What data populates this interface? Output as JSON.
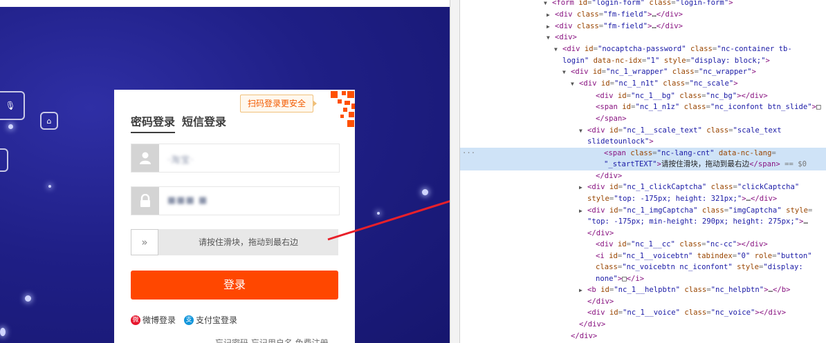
{
  "login": {
    "qr_hint": "扫码登录更安全",
    "tabs": [
      "密码登录",
      "短信登录"
    ],
    "username_value": "·淘宝·",
    "password_value": "■■■  ■",
    "slider_handle": "»",
    "slider_text": "请按住滑块，拖动到最右边",
    "login_button": "登录",
    "alt_logins": [
      {
        "label": "微博登录",
        "icon": "weibo-icon",
        "color": "#e6162d"
      },
      {
        "label": "支付宝登录",
        "icon": "alipay-icon",
        "color": "#1296db"
      }
    ],
    "footer_links": "忘记密码   忘记用户名   免费注册"
  },
  "colors": {
    "banner": "#1f1f86",
    "login_button": "#ff4700",
    "devtools_highlight": "#cfe3f7"
  },
  "devtools": {
    "lines": [
      {
        "tri": "▼",
        "parts": [
          [
            "t",
            "<form "
          ],
          [
            "an",
            "id"
          ],
          [
            "eq",
            "="
          ],
          [
            "av",
            "\"login-form\""
          ],
          [
            "an",
            " class"
          ],
          [
            "eq",
            "="
          ],
          [
            "av",
            "\"login-form\""
          ],
          [
            "t",
            ">"
          ]
        ]
      },
      {
        "tri": "▶",
        "parts": [
          [
            "t",
            "<div "
          ],
          [
            "an",
            "class"
          ],
          [
            "eq",
            "="
          ],
          [
            "av",
            "\"fm-field\""
          ],
          [
            "t",
            ">"
          ],
          [
            "tx",
            "…"
          ],
          [
            "t",
            "</div>"
          ]
        ]
      },
      {
        "tri": "▶",
        "parts": [
          [
            "t",
            "<div "
          ],
          [
            "an",
            "class"
          ],
          [
            "eq",
            "="
          ],
          [
            "av",
            "\"fm-field\""
          ],
          [
            "t",
            ">"
          ],
          [
            "tx",
            "…"
          ],
          [
            "t",
            "</div>"
          ]
        ]
      },
      {
        "tri": "▼",
        "parts": [
          [
            "t",
            "<div>"
          ]
        ]
      },
      {
        "tri": "▼",
        "parts": [
          [
            "t",
            "<div "
          ],
          [
            "an",
            "id"
          ],
          [
            "eq",
            "="
          ],
          [
            "av",
            "\"nocaptcha-password\""
          ],
          [
            "an",
            " class"
          ],
          [
            "eq",
            "="
          ],
          [
            "av",
            "\"nc-container tb-"
          ]
        ]
      },
      {
        "tri": "",
        "parts": [
          [
            "av",
            "login\""
          ],
          [
            "an",
            " data-nc-idx"
          ],
          [
            "eq",
            "="
          ],
          [
            "av",
            "\"1\""
          ],
          [
            "an",
            " style"
          ],
          [
            "eq",
            "="
          ],
          [
            "av",
            "\"display: block;\""
          ],
          [
            "t",
            ">"
          ]
        ]
      },
      {
        "tri": "▼",
        "parts": [
          [
            "t",
            "<div "
          ],
          [
            "an",
            "id"
          ],
          [
            "eq",
            "="
          ],
          [
            "av",
            "\"nc_1_wrapper\""
          ],
          [
            "an",
            " class"
          ],
          [
            "eq",
            "="
          ],
          [
            "av",
            "\"nc_wrapper\""
          ],
          [
            "t",
            ">"
          ]
        ]
      },
      {
        "tri": "▼",
        "parts": [
          [
            "t",
            "<div "
          ],
          [
            "an",
            "id"
          ],
          [
            "eq",
            "="
          ],
          [
            "av",
            "\"nc_1_n1t\""
          ],
          [
            "an",
            " class"
          ],
          [
            "eq",
            "="
          ],
          [
            "av",
            "\"nc_scale\""
          ],
          [
            "t",
            ">"
          ]
        ]
      },
      {
        "tri": "",
        "parts": [
          [
            "t",
            "<div "
          ],
          [
            "an",
            "id"
          ],
          [
            "eq",
            "="
          ],
          [
            "av",
            "\"nc_1__bg\""
          ],
          [
            "an",
            " class"
          ],
          [
            "eq",
            "="
          ],
          [
            "av",
            "\"nc_bg\""
          ],
          [
            "t",
            "></div>"
          ]
        ]
      },
      {
        "tri": "",
        "parts": [
          [
            "t",
            "<span "
          ],
          [
            "an",
            "id"
          ],
          [
            "eq",
            "="
          ],
          [
            "av",
            "\"nc_1_n1z\""
          ],
          [
            "an",
            " class"
          ],
          [
            "eq",
            "="
          ],
          [
            "av",
            "\"nc_iconfont btn_slide\""
          ],
          [
            "t",
            ">"
          ],
          [
            "tx",
            "□"
          ]
        ]
      },
      {
        "tri": "",
        "parts": [
          [
            "t",
            "</span>"
          ]
        ]
      },
      {
        "tri": "▼",
        "parts": [
          [
            "t",
            "<div "
          ],
          [
            "an",
            "id"
          ],
          [
            "eq",
            "="
          ],
          [
            "av",
            "\"nc_1__scale_text\""
          ],
          [
            "an",
            " class"
          ],
          [
            "eq",
            "="
          ],
          [
            "av",
            "\"scale_text"
          ]
        ]
      },
      {
        "tri": "",
        "parts": [
          [
            "av",
            "slidetounlock\""
          ],
          [
            "t",
            ">"
          ]
        ]
      },
      {
        "tri": "",
        "parts": [
          [
            "t",
            "<span "
          ],
          [
            "an",
            "class"
          ],
          [
            "eq",
            "="
          ],
          [
            "av",
            "\"nc-lang-cnt\""
          ],
          [
            "an",
            " data-nc-lang"
          ],
          [
            "eq",
            "="
          ]
        ]
      },
      {
        "tri": "",
        "parts": [
          [
            "av",
            "\"_startTEXT\""
          ],
          [
            "t",
            ">"
          ],
          [
            "tx",
            "请按住滑块，拖动到最右边"
          ],
          [
            "t",
            "</span>"
          ],
          [
            "eq",
            " == $0"
          ]
        ]
      },
      {
        "tri": "",
        "parts": [
          [
            "t",
            "</div>"
          ]
        ]
      },
      {
        "tri": "▶",
        "parts": [
          [
            "t",
            "<div "
          ],
          [
            "an",
            "id"
          ],
          [
            "eq",
            "="
          ],
          [
            "av",
            "\"nc_1_clickCaptcha\""
          ],
          [
            "an",
            " class"
          ],
          [
            "eq",
            "="
          ],
          [
            "av",
            "\"clickCaptcha\""
          ]
        ]
      },
      {
        "tri": "",
        "parts": [
          [
            "an",
            "style"
          ],
          [
            "eq",
            "="
          ],
          [
            "av",
            "\"top: -175px; height: 321px;\""
          ],
          [
            "t",
            ">"
          ],
          [
            "tx",
            "…"
          ],
          [
            "t",
            "</div>"
          ]
        ]
      },
      {
        "tri": "▶",
        "parts": [
          [
            "t",
            "<div "
          ],
          [
            "an",
            "id"
          ],
          [
            "eq",
            "="
          ],
          [
            "av",
            "\"nc_1_imgCaptcha\""
          ],
          [
            "an",
            " class"
          ],
          [
            "eq",
            "="
          ],
          [
            "av",
            "\"imgCaptcha\""
          ],
          [
            "an",
            " style"
          ],
          [
            "eq",
            "="
          ]
        ]
      },
      {
        "tri": "",
        "parts": [
          [
            "av",
            "\"top: -175px; min-height: 290px; height: 275px;\""
          ],
          [
            "t",
            ">"
          ],
          [
            "tx",
            "…"
          ]
        ]
      },
      {
        "tri": "",
        "parts": [
          [
            "t",
            "</div>"
          ]
        ]
      },
      {
        "tri": "",
        "parts": [
          [
            "t",
            "<div "
          ],
          [
            "an",
            "id"
          ],
          [
            "eq",
            "="
          ],
          [
            "av",
            "\"nc_1__cc\""
          ],
          [
            "an",
            " class"
          ],
          [
            "eq",
            "="
          ],
          [
            "av",
            "\"nc-cc\""
          ],
          [
            "t",
            "></div>"
          ]
        ]
      },
      {
        "tri": "",
        "parts": [
          [
            "t",
            "<i "
          ],
          [
            "an",
            "id"
          ],
          [
            "eq",
            "="
          ],
          [
            "av",
            "\"nc_1__voicebtn\""
          ],
          [
            "an",
            " tabindex"
          ],
          [
            "eq",
            "="
          ],
          [
            "av",
            "\"0\""
          ],
          [
            "an",
            " role"
          ],
          [
            "eq",
            "="
          ],
          [
            "av",
            "\"button\""
          ]
        ]
      },
      {
        "tri": "",
        "parts": [
          [
            "an",
            "class"
          ],
          [
            "eq",
            "="
          ],
          [
            "av",
            "\"nc_voicebtn nc_iconfont\""
          ],
          [
            "an",
            " style"
          ],
          [
            "eq",
            "="
          ],
          [
            "av",
            "\"display:"
          ]
        ]
      },
      {
        "tri": "",
        "parts": [
          [
            "av",
            "none\""
          ],
          [
            "t",
            ">"
          ],
          [
            "tx",
            "□"
          ],
          [
            "t",
            "</i>"
          ]
        ]
      },
      {
        "tri": "▶",
        "parts": [
          [
            "t",
            "<b "
          ],
          [
            "an",
            "id"
          ],
          [
            "eq",
            "="
          ],
          [
            "av",
            "\"nc_1__helpbtn\""
          ],
          [
            "an",
            " class"
          ],
          [
            "eq",
            "="
          ],
          [
            "av",
            "\"nc_helpbtn\""
          ],
          [
            "t",
            ">"
          ],
          [
            "tx",
            "…"
          ],
          [
            "t",
            "</b>"
          ]
        ]
      },
      {
        "tri": "",
        "parts": [
          [
            "t",
            "</div>"
          ]
        ]
      },
      {
        "tri": "",
        "parts": [
          [
            "t",
            "<div "
          ],
          [
            "an",
            "id"
          ],
          [
            "eq",
            "="
          ],
          [
            "av",
            "\"nc_1__voice\""
          ],
          [
            "an",
            " class"
          ],
          [
            "eq",
            "="
          ],
          [
            "av",
            "\"nc_voice\""
          ],
          [
            "t",
            "></div>"
          ]
        ]
      },
      {
        "tri": "",
        "parts": [
          [
            "t",
            "</div>"
          ]
        ]
      },
      {
        "tri": "",
        "parts": [
          [
            "t",
            "</div>"
          ]
        ]
      }
    ]
  }
}
